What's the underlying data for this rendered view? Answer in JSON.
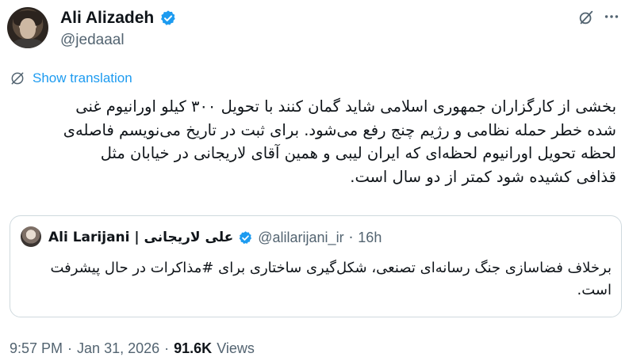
{
  "author": {
    "name": "Ali Alizadeh",
    "handle": "@jedaaal",
    "verified_icon": "verified-badge-icon"
  },
  "header_actions": {
    "grok_icon": "grok-icon",
    "more_icon": "more-horizontal-icon"
  },
  "translation": {
    "label": "Show translation",
    "icon": "globe-translate-icon"
  },
  "tweet": {
    "lines": [
      "بخشی از کارگزاران جمهوری اسلامی شاید گمان کنند با تحویل ۳۰۰ کیلو اورانیوم غنی",
      "شده خطر حمله نظامی و رژیم چنج رفع می‌شود. برای ثبت در تاریخ می‌نویسم فاصله‌ی",
      "لحظه تحویل اورانیوم لحظه‌ای که ایران لیبی و همین آقای لاریجانی در خیابان مثل",
      "قذافی کشیده شود کمتر از دو سال است."
    ]
  },
  "quote": {
    "name": "Ali Larijani | علی لاریجانی",
    "handle": "@alilarijani_ir",
    "separator": "·",
    "time": "16h",
    "lines": [
      "برخلاف فضاسازی جنگ رسانه‌ای تصنعی، شکل‌گیری ساختاری برای #مذاکرات در حال پیشرفت",
      "است."
    ]
  },
  "meta": {
    "time": "9:57 PM",
    "separator": "·",
    "date": "Jan 31, 2026",
    "views_count": "91.6K",
    "views_label": "Views"
  },
  "colors": {
    "accent": "#1d9bf0",
    "text": "#0f1419",
    "secondary": "#536471",
    "border": "#cfd9de"
  }
}
